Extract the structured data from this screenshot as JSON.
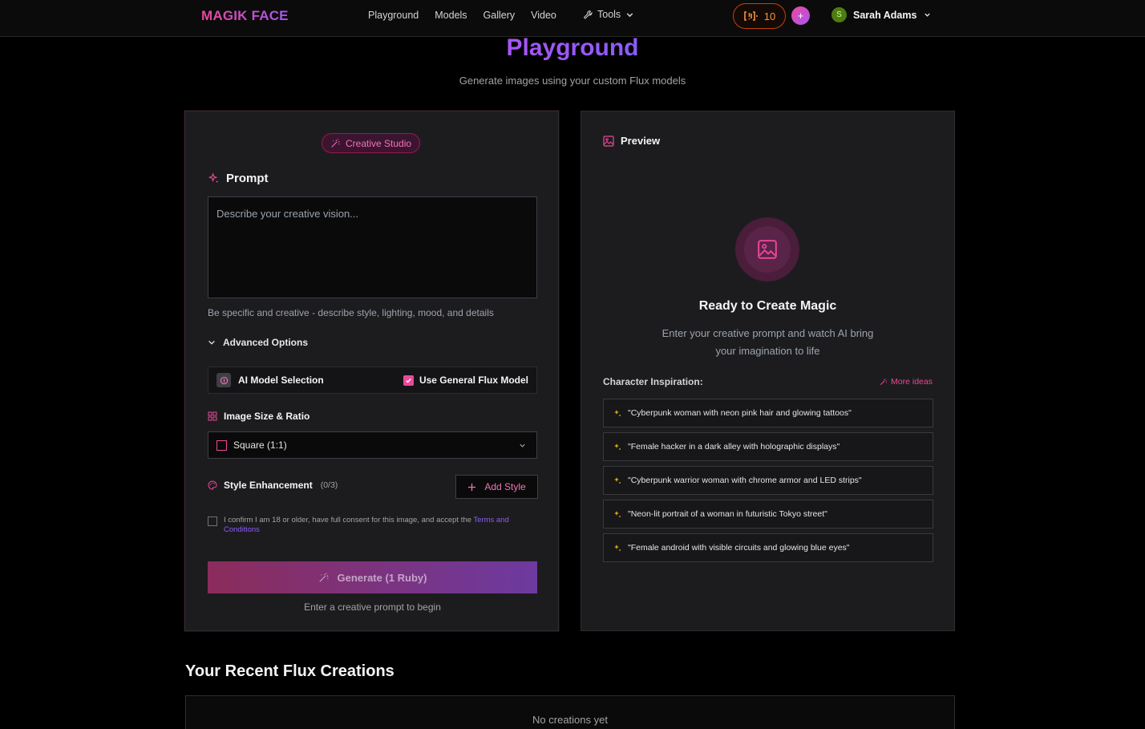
{
  "nav": {
    "logo": "MAGIK FACE",
    "links": [
      "Playground",
      "Models",
      "Gallery",
      "Video"
    ],
    "tools_label": "Tools",
    "ruby_count": "10",
    "user_initial": "S",
    "user_name": "Sarah Adams"
  },
  "header": {
    "title": "Playground",
    "subtitle": "Generate images using your custom Flux models"
  },
  "editor": {
    "badge": "Creative Studio",
    "prompt_label": "Prompt",
    "prompt_placeholder": "Describe your creative vision...",
    "prompt_value": "",
    "prompt_hint": "Be specific and creative - describe style, lighting, mood, and details",
    "advanced_label": "Advanced Options",
    "model_label": "AI Model Selection",
    "general_flux_label": "Use General Flux Model",
    "general_flux_checked": true,
    "size_label": "Image Size & Ratio",
    "size_value": "Square (1:1)",
    "style_label": "Style Enhancement",
    "style_count": "(0/3)",
    "add_style_label": "Add Style",
    "consent_text": "I confirm I am 18 or older, have full consent for this image, and accept the ",
    "consent_link": "Terms and Conditions",
    "generate_label": "Generate (1 Ruby)",
    "generate_hint": "Enter a creative prompt to begin"
  },
  "preview": {
    "label": "Preview",
    "ready_title": "Ready to Create Magic",
    "ready_line1": "Enter your creative prompt and watch AI bring",
    "ready_line2": "your imagination to life",
    "inspiration_label": "Character Inspiration:",
    "more_ideas": "More ideas",
    "ideas": [
      "\"Cyberpunk woman with neon pink hair and glowing tattoos\"",
      "\"Female hacker in a dark alley with holographic displays\"",
      "\"Cyberpunk warrior woman with chrome armor and LED strips\"",
      "\"Neon-lit portrait of a woman in futuristic Tokyo street\"",
      "\"Female android with visible circuits and glowing blue eyes\""
    ]
  },
  "recent": {
    "title": "Your Recent Flux Creations",
    "empty": "No creations yet"
  },
  "colors": {
    "accent_pink": "#ec4899",
    "accent_purple": "#a855f7",
    "ruby_orange": "#fb923c",
    "background": "#000000",
    "panel": "#1c1c1e"
  },
  "icons": {
    "tools": "wrench-icon",
    "ruby": "ruby-icon",
    "badge": "magic-wand-icon",
    "prompt": "sparkles-icon",
    "model": "cpu-icon",
    "size": "grid-icon",
    "style": "palette-icon",
    "preview": "image-icon"
  }
}
